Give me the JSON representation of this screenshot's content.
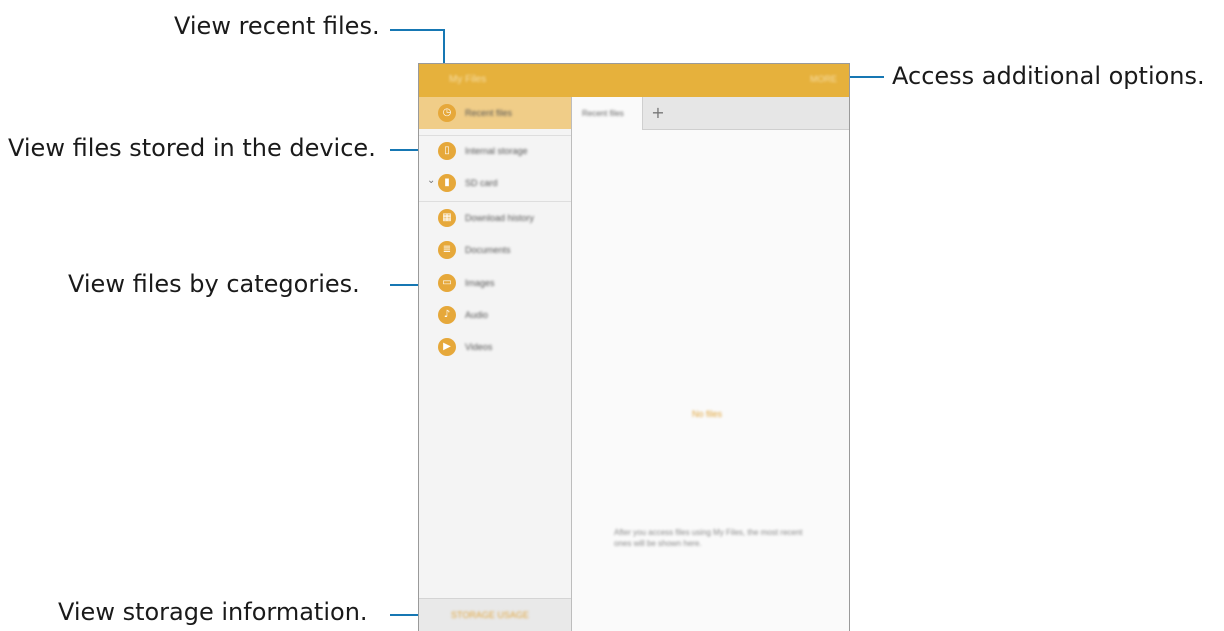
{
  "callouts": {
    "recent": "View recent files.",
    "device": "View files stored in the device.",
    "categories": "View files by categories.",
    "storage": "View storage information.",
    "options": "Access additional options."
  },
  "app": {
    "title": "My Files",
    "more": "MORE"
  },
  "sidebar": {
    "items": [
      {
        "label": "Recent files",
        "icon": "clock-icon"
      },
      {
        "label": "Internal storage",
        "icon": "device-icon"
      },
      {
        "label": "SD card",
        "icon": "sd-card-icon"
      },
      {
        "label": "Download history",
        "icon": "download-history-icon"
      },
      {
        "label": "Documents",
        "icon": "document-icon"
      },
      {
        "label": "Images",
        "icon": "image-icon"
      },
      {
        "label": "Audio",
        "icon": "music-note-icon"
      },
      {
        "label": "Videos",
        "icon": "video-icon"
      }
    ],
    "storage_label": "STORAGE USAGE"
  },
  "main": {
    "tab_label": "Recent files",
    "add_tab": "+",
    "empty_title": "No files",
    "empty_hint": "After you access files using My Files, the most recent ones will be shown here."
  },
  "colors": {
    "accent": "#e6b13c",
    "icon": "#e6a83a",
    "callout_line": "#1677b3",
    "active_item": "#f0cd88"
  }
}
